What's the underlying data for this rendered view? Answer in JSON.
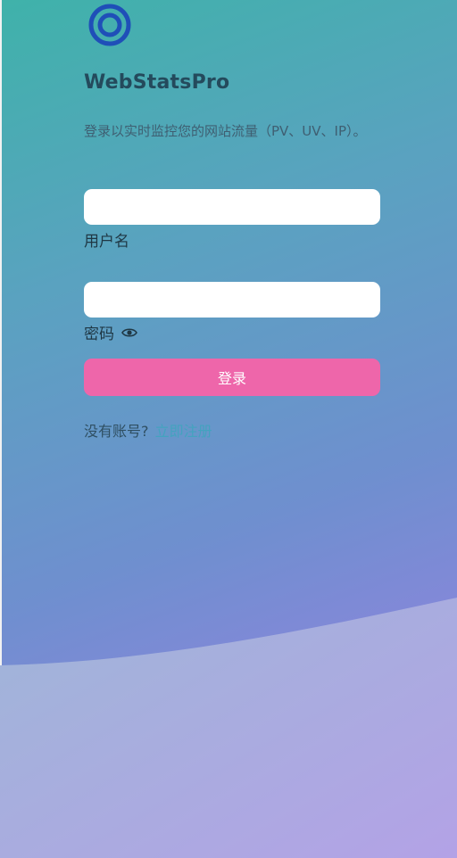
{
  "app": {
    "title": "WebStatsPro",
    "subtitle": "登录以实时监控您的网站流量（PV、UV、IP）。"
  },
  "form": {
    "username_label": "用户名",
    "username_value": "",
    "password_label": "密码",
    "password_value": "",
    "login_button": "登录"
  },
  "signup": {
    "prompt": "没有账号?",
    "link_label": "立即注册"
  },
  "icons": {
    "logo": "ring-logo-icon",
    "password_toggle": "eye-icon"
  },
  "colors": {
    "accent_button": "#ee66aa",
    "logo": "#1f4fb8",
    "link": "#43a3bf"
  }
}
